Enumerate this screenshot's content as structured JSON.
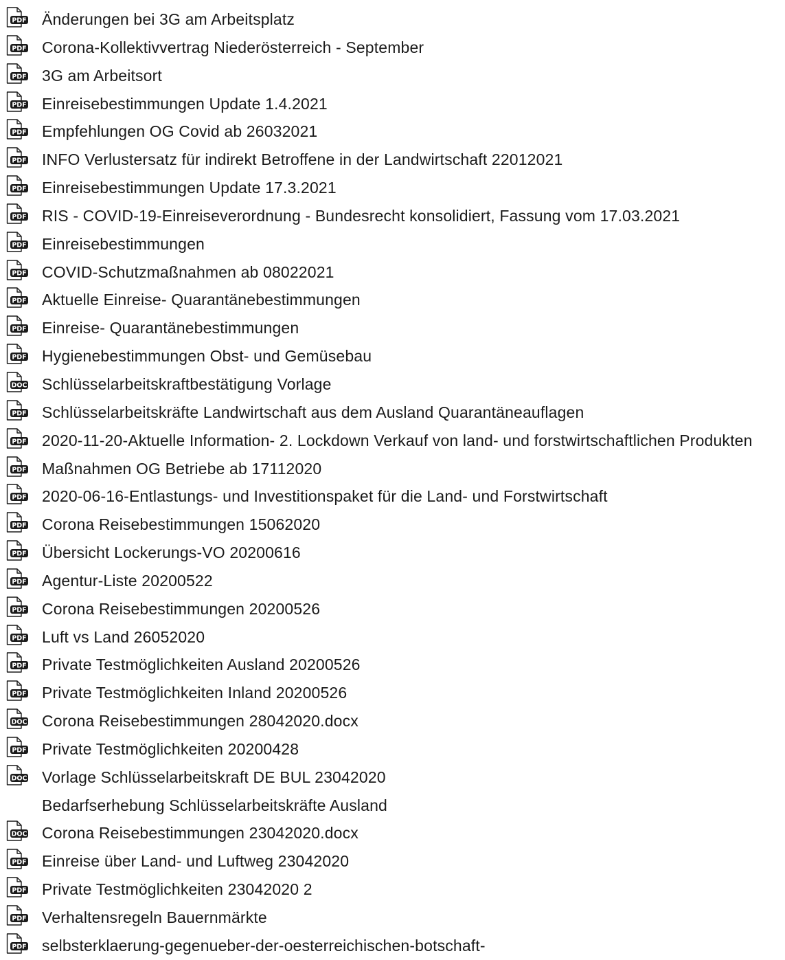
{
  "files": [
    {
      "title": "Änderungen bei 3G am Arbeitsplatz",
      "icon": "pdf-file-icon"
    },
    {
      "title": "Corona-Kollektivvertrag Niederösterreich - September",
      "icon": "pdf-file-icon"
    },
    {
      "title": "3G am Arbeitsort",
      "icon": "pdf-file-icon"
    },
    {
      "title": "Einreisebestimmungen Update 1.4.2021",
      "icon": "pdf-file-icon"
    },
    {
      "title": "Empfehlungen OG Covid ab 26032021",
      "icon": "pdf-file-icon"
    },
    {
      "title": "INFO Verlustersatz für indirekt Betroffene in der Landwirtschaft 22012021",
      "icon": "pdf-file-icon"
    },
    {
      "title": "Einreisebestimmungen Update 17.3.2021",
      "icon": "pdf-file-icon"
    },
    {
      "title": "RIS - COVID-19-Einreiseverordnung - Bundesrecht konsolidiert, Fassung vom 17.03.2021",
      "icon": "pdf-file-icon"
    },
    {
      "title": "Einreisebestimmungen",
      "icon": "pdf-file-icon"
    },
    {
      "title": "COVID-Schutzmaßnahmen ab 08022021",
      "icon": "pdf-file-icon"
    },
    {
      "title": "Aktuelle Einreise- Quarantänebestimmungen",
      "icon": "pdf-file-icon"
    },
    {
      "title": "Einreise- Quarantänebestimmungen",
      "icon": "pdf-file-icon"
    },
    {
      "title": "Hygienebestimmungen Obst- und Gemüsebau",
      "icon": "pdf-file-icon"
    },
    {
      "title": "Schlüsselarbeitskraftbestätigung Vorlage",
      "icon": "doc-file-icon"
    },
    {
      "title": "Schlüsselarbeitskräfte Landwirtschaft aus dem Ausland Quarantäneauflagen",
      "icon": "pdf-file-icon"
    },
    {
      "title": "2020-11-20-Aktuelle Information- 2. Lockdown Verkauf von land- und forstwirtschaftlichen Produkten",
      "icon": "pdf-file-icon"
    },
    {
      "title": "Maßnahmen OG Betriebe ab 17112020",
      "icon": "pdf-file-icon"
    },
    {
      "title": "2020-06-16-Entlastungs- und Investitionspaket für die Land- und Forstwirtschaft",
      "icon": "pdf-file-icon"
    },
    {
      "title": "Corona Reisebestimmungen 15062020",
      "icon": "pdf-file-icon"
    },
    {
      "title": "Übersicht Lockerungs-VO 20200616",
      "icon": "pdf-file-icon"
    },
    {
      "title": "Agentur-Liste 20200522",
      "icon": "pdf-file-icon"
    },
    {
      "title": "Corona Reisebestimmungen 20200526",
      "icon": "pdf-file-icon"
    },
    {
      "title": "Luft vs Land 26052020",
      "icon": "pdf-file-icon"
    },
    {
      "title": "Private Testmöglichkeiten Ausland 20200526",
      "icon": "pdf-file-icon"
    },
    {
      "title": "Private Testmöglichkeiten Inland 20200526",
      "icon": "pdf-file-icon"
    },
    {
      "title": "Corona Reisebestimmungen 28042020.docx",
      "icon": "doc-file-icon"
    },
    {
      "title": "Private Testmöglichkeiten 20200428",
      "icon": "pdf-file-icon"
    },
    {
      "title": "Vorlage Schlüsselarbeitskraft DE BUL 23042020",
      "icon": "doc-file-icon"
    },
    {
      "title": "Bedarfserhebung Schlüsselarbeitskräfte Ausland",
      "icon": ""
    },
    {
      "title": "Corona Reisebestimmungen 23042020.docx",
      "icon": "doc-file-icon"
    },
    {
      "title": "Einreise über Land- und Luftweg 23042020",
      "icon": "pdf-file-icon"
    },
    {
      "title": "Private Testmöglichkeiten 23042020 2",
      "icon": "pdf-file-icon"
    },
    {
      "title": "Verhaltensregeln Bauernmärkte",
      "icon": "pdf-file-icon"
    },
    {
      "title": "selbsterklaerung-gegenueber-der-oesterreichischen-botschaft-",
      "icon": "pdf-file-icon"
    }
  ],
  "badges": {
    "pdf": "PDF",
    "doc": "DOC"
  },
  "colors": {
    "text": "#1a1a1a",
    "icon_stroke": "#1a1a1a",
    "badge_fill": "#1a1a1a",
    "badge_text": "#ffffff",
    "background": "#ffffff"
  }
}
